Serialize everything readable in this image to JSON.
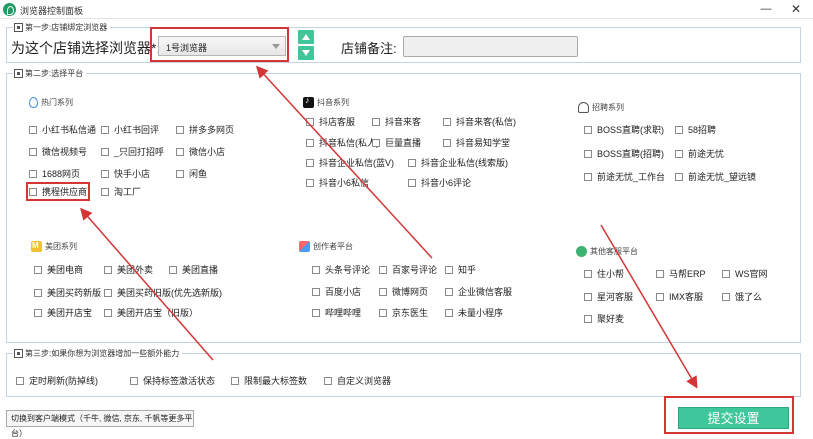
{
  "window": {
    "title": "浏览器控制面板",
    "minimize": "—",
    "close": "✕"
  },
  "step1": {
    "legend": "第一步:店铺绑定浏览器",
    "label": "为这个店铺选择浏览器*:",
    "selected_browser": "1号浏览器",
    "note_label": "店铺备注:",
    "note_value": ""
  },
  "step2": {
    "legend": "第二步:选择平台",
    "groups": [
      {
        "title": "热门系列",
        "icon": "fire-icon",
        "items": [
          "小红书私信通",
          "小红书回评",
          "拼多多网页",
          "微信视频号",
          "_只回打招呼",
          "微信小店",
          "1688网页",
          "快手小店",
          "闲鱼",
          "携程供应商",
          "淘工厂"
        ]
      },
      {
        "title": "抖音系列",
        "icon": "tiktok-icon",
        "items": [
          "抖店客服",
          "抖音来客",
          "抖音来客(私信)",
          "抖音私信(私人)",
          "巨量直播",
          "抖音易知学堂",
          "抖音企业私信(蓝V)",
          "抖音企业私信(线索版)",
          "抖音小6私信",
          "抖音小6评论"
        ]
      },
      {
        "title": "招聘系列",
        "icon": "recruit-icon",
        "items": [
          "BOSS直聘(求职)",
          "58招聘",
          "BOSS直聘(招聘)",
          "前途无忧",
          "前途无忧_工作台",
          "前途无忧_望远镜"
        ]
      },
      {
        "title": "美团系列",
        "icon": "meituan-icon",
        "items": [
          "美团电商",
          "美团外卖",
          "美团直播",
          "美团买药新版",
          "美团买药旧版(优先选新版)",
          "美团开店宝",
          "美团开店宝（旧版）"
        ]
      },
      {
        "title": "创作者平台",
        "icon": "creator-icon",
        "items": [
          "头条号评论",
          "百家号评论",
          "知乎",
          "百度小店",
          "微博网页",
          "企业微信客服",
          "哔哩哔哩",
          "京东医生",
          "未量小程序"
        ]
      },
      {
        "title": "其他客服平台",
        "icon": "service-icon",
        "items": [
          "住小帮",
          "马帮ERP",
          "WS官网",
          "星河客服",
          "IMX客服",
          "饿了么",
          "聚好麦"
        ]
      }
    ]
  },
  "step3": {
    "legend": "第三步:如果你想为浏览器增加一些额外能力",
    "options": [
      "定时刷新(防掉线)",
      "保持标签激活状态",
      "限制最大标签数",
      "自定义浏览器"
    ]
  },
  "footer": {
    "switch_label": "切换到客户端模式（千牛, 微信, 京东, 千帆等更多平台）",
    "submit_label": "提交设置"
  },
  "colors": {
    "accent": "#3ec79a",
    "highlight": "#d43636",
    "border": "#c7d2e0"
  }
}
